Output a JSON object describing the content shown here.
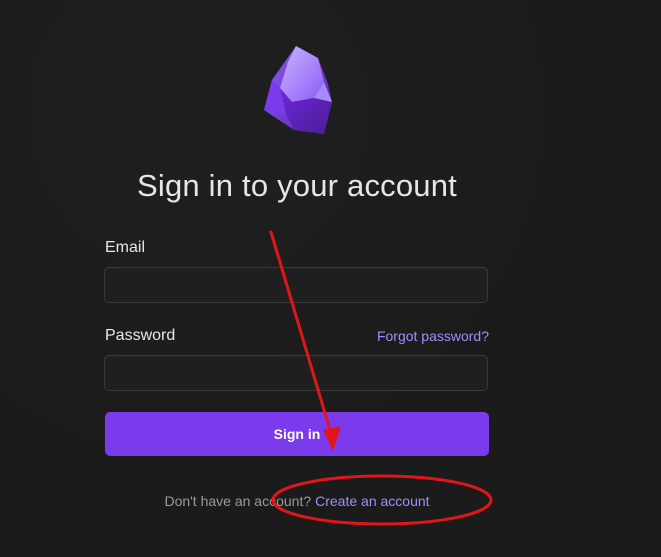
{
  "title": "Sign in to your account",
  "form": {
    "email_label": "Email",
    "email_value": "",
    "password_label": "Password",
    "password_value": "",
    "forgot_link": "Forgot password?",
    "submit_label": "Sign in"
  },
  "footer": {
    "prompt": "Don't have an account?",
    "create_link": "Create an account"
  },
  "icons": {
    "logo": "obsidian-crystal-logo-icon"
  },
  "colors": {
    "background": "#1b1b1b",
    "accent": "#7c3aed",
    "link": "#a78bfa",
    "annotation": "#e0161b"
  }
}
